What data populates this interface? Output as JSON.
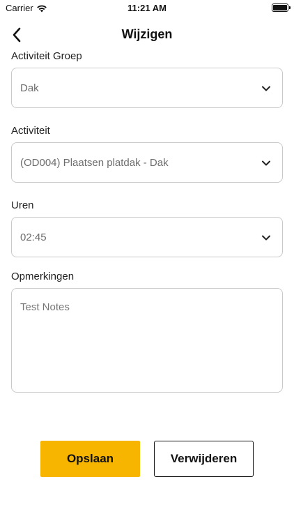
{
  "status_bar": {
    "carrier": "Carrier",
    "time": "11:21 AM"
  },
  "nav": {
    "title": "Wijzigen",
    "back_icon": "chevron-left-icon"
  },
  "form": {
    "activity_group": {
      "label": "Activiteit Groep",
      "value": "Dak"
    },
    "activity": {
      "label": "Activiteit",
      "value": "(OD004) Plaatsen platdak - Dak"
    },
    "hours": {
      "label": "Uren",
      "value": "02:45"
    },
    "remarks": {
      "label": "Opmerkingen",
      "value": "Test Notes"
    }
  },
  "actions": {
    "save_label": "Opslaan",
    "delete_label": "Verwijderen"
  },
  "colors": {
    "accent": "#f7b500",
    "border": "#c9c9c9"
  }
}
